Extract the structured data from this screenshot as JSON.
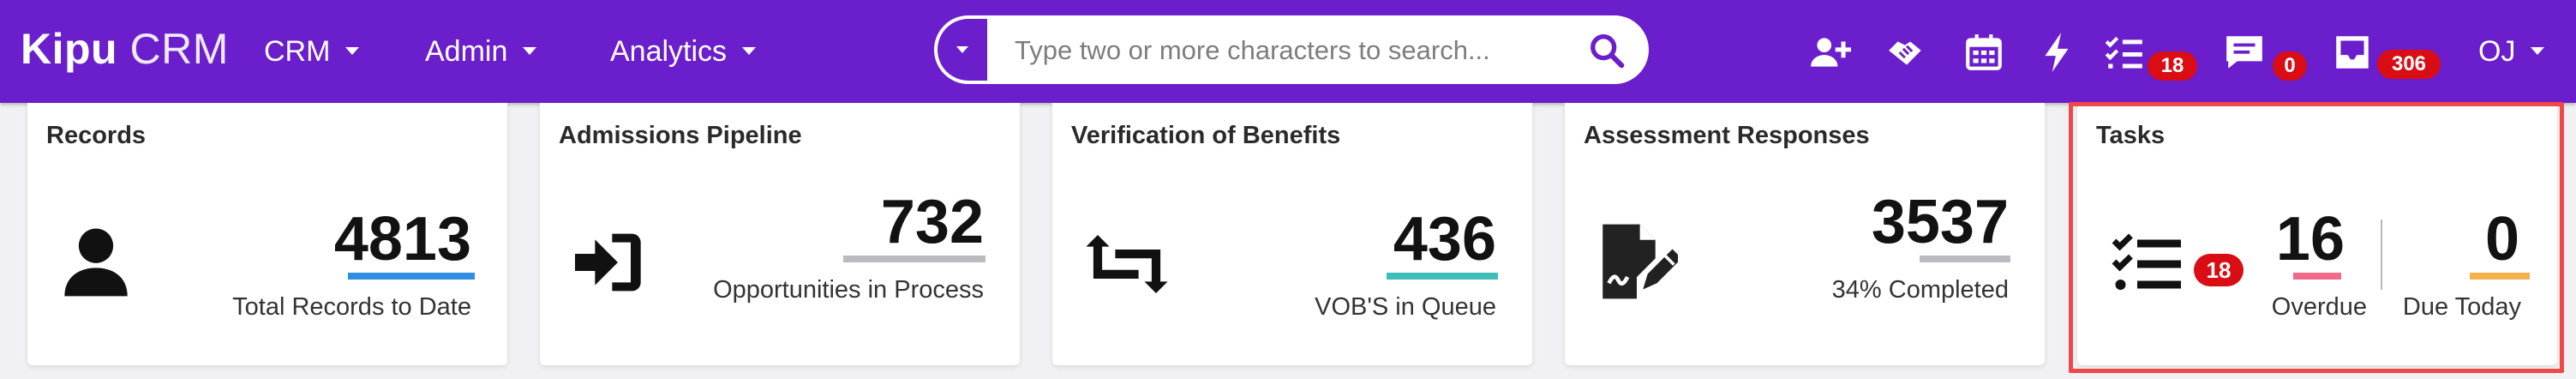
{
  "brand": {
    "name_bold": "Kipu",
    "name_light": "CRM"
  },
  "nav": {
    "menus": [
      {
        "label": "CRM"
      },
      {
        "label": "Admin"
      },
      {
        "label": "Analytics"
      }
    ],
    "search": {
      "placeholder": "Type two or more characters to search...",
      "value": ""
    },
    "icons": {
      "add_user": "add-user-icon",
      "handshake": "handshake-icon",
      "calendar": "calendar-icon",
      "bolt": "bolt-icon",
      "tasks": "task-checklist-icon",
      "messages": "chat-icon",
      "inbox": "inbox-icon"
    },
    "badges": {
      "tasks": "18",
      "messages": "0",
      "inbox": "306"
    },
    "user_initials": "OJ"
  },
  "cards": {
    "records": {
      "title": "Records",
      "value": "4813",
      "subtitle": "Total Records to Date",
      "underline_color": "#2e8fe0",
      "icon": "person-icon"
    },
    "admissions": {
      "title": "Admissions Pipeline",
      "value": "732",
      "subtitle": "Opportunities in Process",
      "underline_color": "#b8bcc0",
      "icon": "sign-in-icon"
    },
    "vob": {
      "title": "Verification of Benefits",
      "value": "436",
      "subtitle": "VOB'S in Queue",
      "underline_color": "#3dbdb5",
      "icon": "exchange-icon"
    },
    "assessment": {
      "title": "Assessment Responses",
      "value": "3537",
      "subtitle": "34% Completed",
      "underline_color": "#b8bcc0",
      "icon": "signed-document-icon"
    },
    "tasks": {
      "title": "Tasks",
      "icon": "task-list-icon",
      "badge": "18",
      "overdue": {
        "value": "16",
        "label": "Overdue",
        "underline_color": "#f06a8a"
      },
      "due_today": {
        "value": "0",
        "label": "Due Today",
        "underline_color": "#f5b04a"
      }
    }
  },
  "colors": {
    "nav": "#6b1ecb",
    "badge": "#d90d13",
    "highlight": "#ef4848"
  }
}
